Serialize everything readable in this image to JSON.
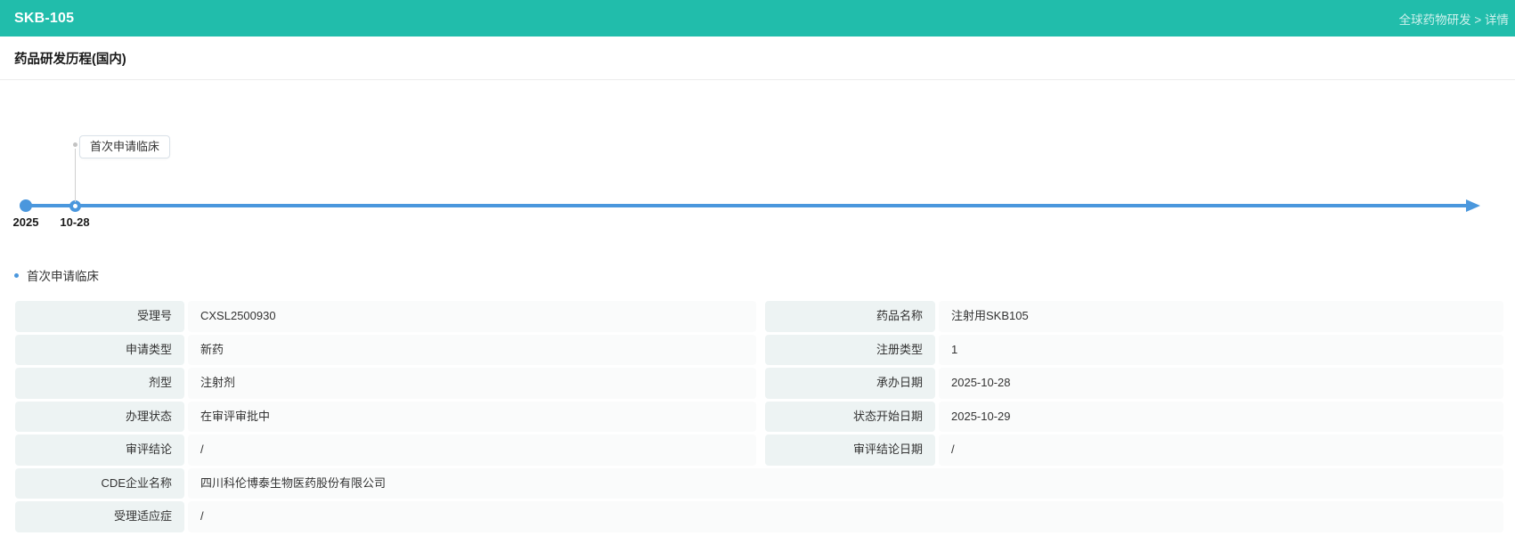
{
  "header": {
    "title": "SKB-105",
    "breadcrumb": "全球药物研发 > 详情"
  },
  "page": {
    "section_title": "药品研发历程(国内)"
  },
  "timeline": {
    "year": "2025",
    "event": {
      "date": "10-28",
      "tooltip": "首次申请临床"
    },
    "axis_color": "#4a97dd"
  },
  "detail": {
    "heading": "首次申请临床",
    "fields_left": [
      {
        "label": "受理号",
        "value": "CXSL2500930"
      },
      {
        "label": "申请类型",
        "value": "新药"
      },
      {
        "label": "剂型",
        "value": "注射剂"
      },
      {
        "label": "办理状态",
        "value": "在审评审批中"
      },
      {
        "label": "审评结论",
        "value": "/"
      }
    ],
    "fields_right": [
      {
        "label": "药品名称",
        "value": "注射用SKB105"
      },
      {
        "label": "注册类型",
        "value": "1"
      },
      {
        "label": "承办日期",
        "value": "2025-10-28"
      },
      {
        "label": "状态开始日期",
        "value": "2025-10-29"
      },
      {
        "label": "审评结论日期",
        "value": "/"
      }
    ],
    "fields_full": [
      {
        "label": "CDE企业名称",
        "value": "四川科伦博泰生物医药股份有限公司"
      },
      {
        "label": "受理适应症",
        "value": "/"
      }
    ]
  },
  "colors": {
    "teal": "#21bdab",
    "blue": "#4a97dd",
    "label_bg": "#edf3f3",
    "value_bg": "#fafbfb"
  }
}
